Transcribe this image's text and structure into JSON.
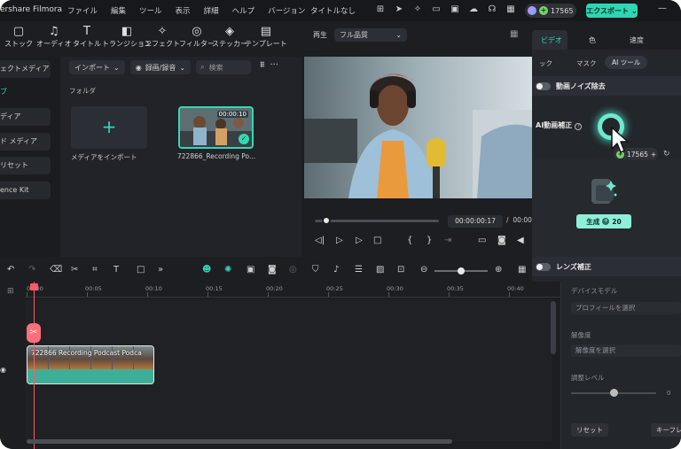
{
  "titlebar": {
    "app_name": "ershare Filmora",
    "menu": [
      "ファイル",
      "編集",
      "ツール",
      "表示",
      "詳細",
      "ヘルプ",
      "バージョン"
    ],
    "doc_title": "タイトルなし",
    "credits": "17565",
    "export_label": "エクスポート"
  },
  "tools": [
    "ストック",
    "オーディオ",
    "タイトル",
    "トランジション",
    "エフェクト",
    "フィルター",
    "ステッカー",
    "テンプレート"
  ],
  "sidebar": {
    "items": [
      "ェクトメディア",
      "ブ",
      "ディア",
      "ド メディア",
      "リセット",
      "ence Kit"
    ]
  },
  "media": {
    "import_dropdown": "インポート",
    "filter_dropdown": "録画/録音",
    "search_placeholder": "検索",
    "folder_label": "フォルダ",
    "import_label": "メディアをインポート",
    "clip_name": "722866_Recording Po...",
    "clip_duration": "00:00:10"
  },
  "preview": {
    "play_label": "再生",
    "quality": "フル品質",
    "timecode_current": "00:00:00:17",
    "timecode_separator": "/",
    "timecode_total": "00:00"
  },
  "right_panel": {
    "tabs": [
      "ビデオ",
      "色",
      "速度"
    ],
    "subtabs": [
      "ック",
      "マスク",
      "AI ツール"
    ],
    "denoise_label": "動画ノイズ除去",
    "ai_enhance_label": "AI動画補正",
    "ai_help": "?",
    "credits": "17565",
    "generate_label": "生成",
    "generate_cost": "20",
    "lens_label": "レンズ補正",
    "device_model_label": "デバイスモデル",
    "profile_placeholder": "プロフィールを選択",
    "resolution_label": "解像度",
    "resolution_placeholder": "解像度を選択",
    "adjust_level_label": "調整レベル",
    "adjust_level_value": "0",
    "reset_label": "リセット",
    "keyframe_label": "キーフレー"
  },
  "timeline": {
    "ticks": [
      "00:00",
      "00:05",
      "00:10",
      "00:15",
      "00:20",
      "00:25",
      "00:30",
      "00:35",
      "00:40"
    ],
    "clip_title": "722866 Recording Podcast Podca"
  },
  "colors": {
    "accent": "#34d7b4",
    "playhead": "#ff5a6a",
    "clip": "#47b7a0"
  }
}
